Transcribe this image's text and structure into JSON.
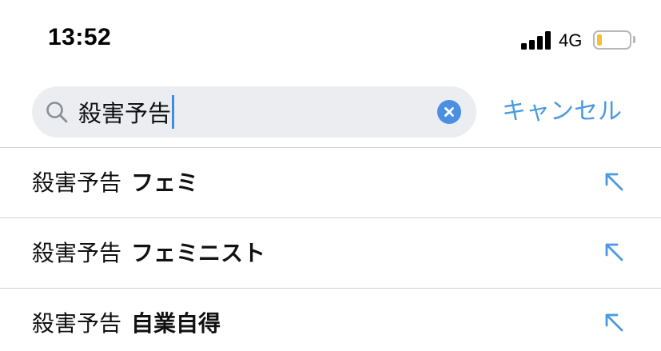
{
  "status_bar": {
    "time": "13:52",
    "network": "4G",
    "battery_level": 0.15,
    "battery_color": "#f2c233"
  },
  "search": {
    "query": "殺害予告",
    "search_icon": "search-icon",
    "clear_icon": "clear-icon",
    "cancel_label": "キャンセル"
  },
  "suggestions": [
    {
      "query": "殺害予告",
      "completion": "フェミ",
      "icon": "arrow-up-left-icon"
    },
    {
      "query": "殺害予告",
      "completion": "フェミニスト",
      "icon": "arrow-up-left-icon"
    },
    {
      "query": "殺害予告",
      "completion": "自業自得",
      "icon": "arrow-up-left-icon"
    }
  ],
  "colors": {
    "accent": "#4a9ae0",
    "search_field_bg": "#ebedf0",
    "divider": "#d3d3d3"
  }
}
